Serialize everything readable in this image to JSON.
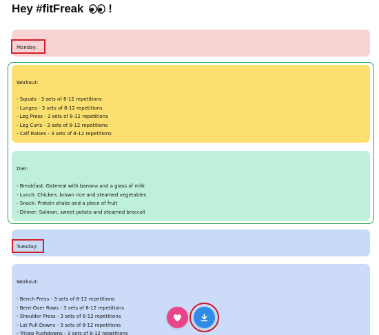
{
  "header": {
    "title": "Hey #fitFreak",
    "title_suffix": "!",
    "eyes_icon": "eyes-emoji"
  },
  "days": [
    {
      "day_label": "Monday:",
      "workout": {
        "heading": "Workout:",
        "items": [
          "- Squats - 3 sets of 8-12 repetitions",
          "- Lunges - 3 sets of 8-12 repetitions",
          "- Leg Press - 3 sets of 8-12 repetitions",
          "- Leg Curls - 3 sets of 8-12 repetitions",
          "- Calf Raises - 3 sets of 8-12 repetitions"
        ]
      },
      "diet": {
        "heading": "Diet:",
        "items": [
          "- Breakfast: Oatmeal with banana and a glass of milk",
          "- Lunch: Chicken, brown rice and steamed vegetables",
          "- Snack: Protein shake and a piece of fruit",
          "- Dinner: Salmon, sweet potato and steamed broccoli"
        ]
      }
    },
    {
      "day_label": "Tuesday:",
      "workout": {
        "heading": "Workout:",
        "items": [
          "- Bench Press - 3 sets of 8-12 repetitions",
          "- Bent-Over Rows - 3 sets of 8-12 repetitions",
          "- Shoulder Press - 3 sets of 8-12 repetitions",
          "- Lat Pull-Downs - 3 sets of 8-12 repetitions",
          "- Tricep Pushdowns - 3 sets of 8-12 repetitions"
        ]
      }
    }
  ],
  "actions": {
    "like_icon": "heart-icon",
    "download_icon": "download-icon"
  },
  "colors": {
    "day_card_monday": "#f9d3d3",
    "workout_card": "#fbe070",
    "diet_card": "#bff0db",
    "day_card_tuesday": "#c8dbf6",
    "workout_card_tuesday": "#ccdcf8",
    "like_button": "#e8458a",
    "download_button": "#2f8ce6",
    "highlight_red": "#d1202a",
    "selection_green": "#1e9e3b"
  }
}
